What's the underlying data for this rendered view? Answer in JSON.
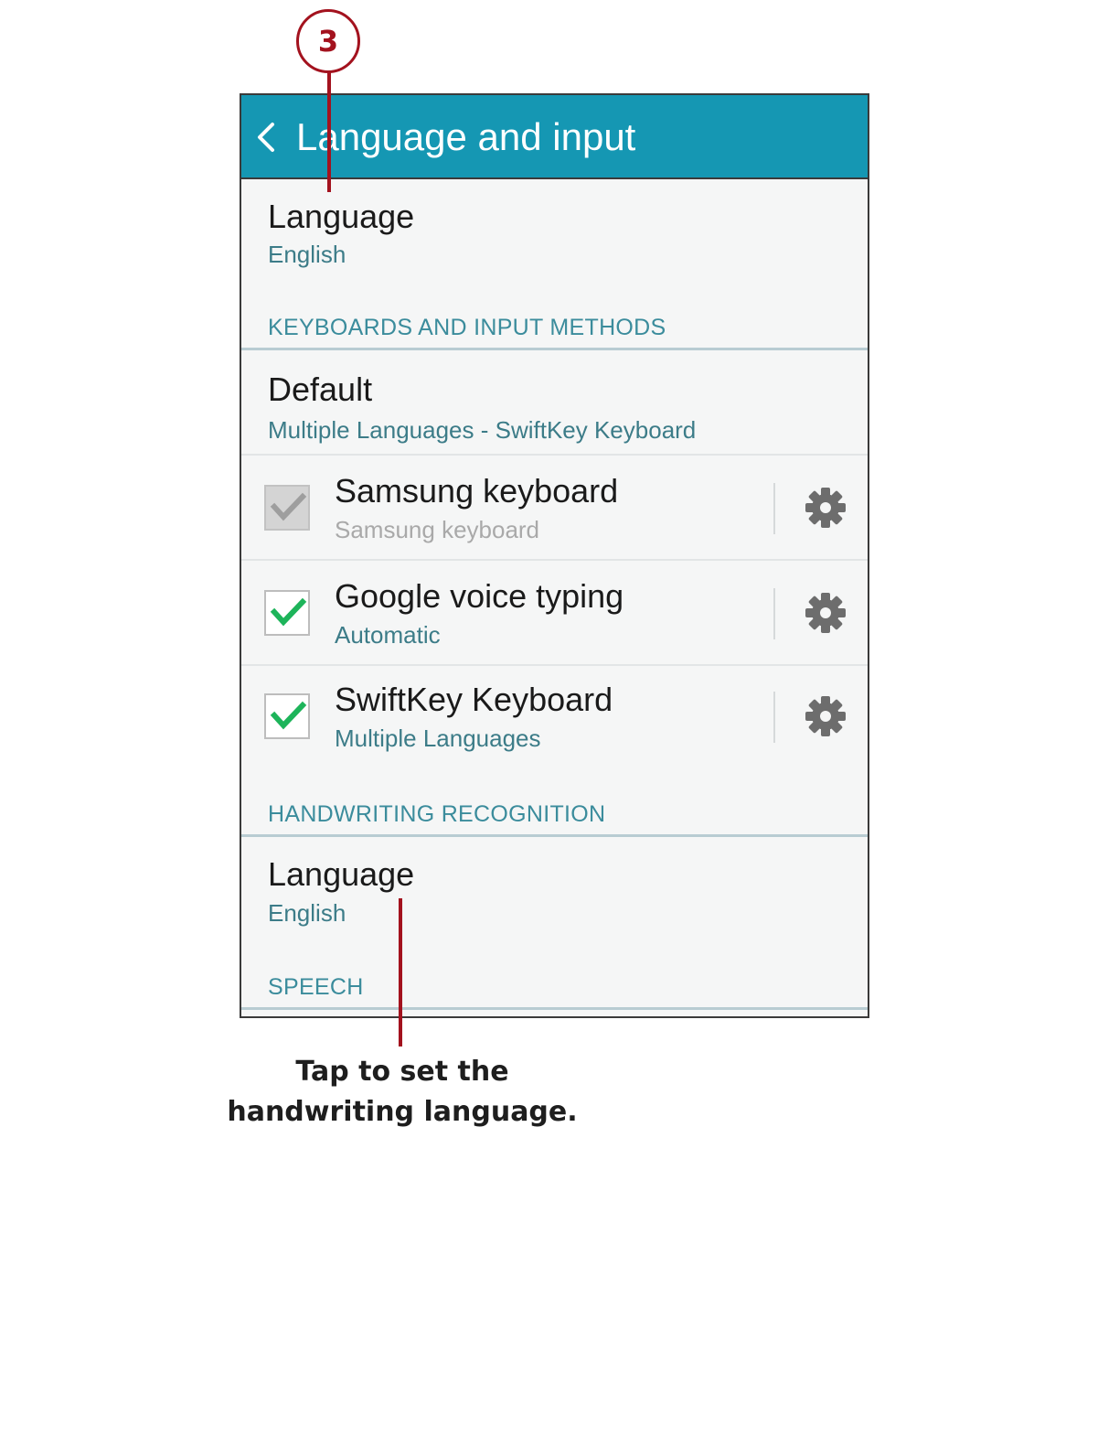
{
  "callout": {
    "step_number": "3"
  },
  "caption": {
    "line1": "Tap to set the",
    "line2": "handwriting language."
  },
  "screen": {
    "title": "Language and input",
    "language": {
      "title": "Language",
      "value": "English"
    },
    "sections": {
      "keyboards": "KEYBOARDS AND INPUT METHODS",
      "handwriting": "HANDWRITING RECOGNITION",
      "speech": "SPEECH"
    },
    "default_item": {
      "title": "Default",
      "value": "Multiple Languages - SwiftKey Keyboard"
    },
    "keyboards": [
      {
        "title": "Samsung keyboard",
        "subtitle": "Samsung keyboard",
        "checked": true,
        "enabled": false
      },
      {
        "title": "Google voice typing",
        "subtitle": "Automatic",
        "checked": true,
        "enabled": true
      },
      {
        "title": "SwiftKey Keyboard",
        "subtitle": "Multiple Languages",
        "checked": true,
        "enabled": true
      }
    ],
    "handwriting_language": {
      "title": "Language",
      "value": "English"
    }
  },
  "colors": {
    "app_bar": "#1597b3",
    "accent_text": "#3b8c9c",
    "checkmark": "#1db45a",
    "callout": "#a3121e"
  },
  "icons": [
    "back-arrow-icon",
    "checkmark-icon",
    "gear-icon"
  ]
}
